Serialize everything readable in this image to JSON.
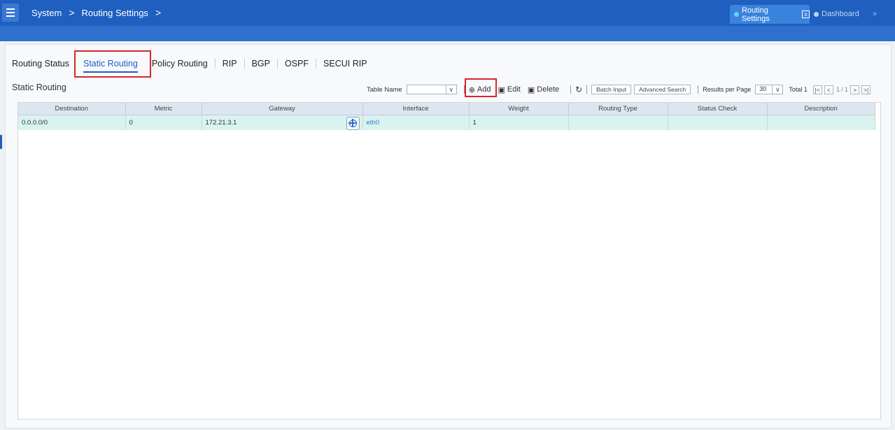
{
  "breadcrumb": {
    "item1": "System",
    "item2": "Routing Settings",
    "sep": ">"
  },
  "window_tabs": {
    "active": "Routing Settings",
    "close": "x",
    "second": "Dashboard",
    "more": "»"
  },
  "tabs": [
    {
      "label": "Routing Status"
    },
    {
      "label": "Static Routing"
    },
    {
      "label": "Policy Routing"
    },
    {
      "label": "RIP"
    },
    {
      "label": "BGP"
    },
    {
      "label": "OSPF"
    },
    {
      "label": "SECUI RIP"
    }
  ],
  "section_title": "Static Routing",
  "toolbar": {
    "table_name_label": "Table Name",
    "table_name_value": "",
    "add_label": "Add",
    "edit_label": "Edit",
    "delete_label": "Delete",
    "batch_input_label": "Batch Input",
    "advanced_search_label": "Advanced Search",
    "results_per_page_label": "Results per Page",
    "results_per_page_value": "30",
    "total_label": "Total 1",
    "page_current": "1",
    "page_total": "1"
  },
  "table": {
    "columns": [
      "Destination",
      "Metric",
      "Gateway",
      "Interface",
      "Weight",
      "Routing Type",
      "Status Check",
      "Description"
    ],
    "rows": [
      {
        "destination": "0.0.0.0/0",
        "metric": "0",
        "gateway": "172.21.3.1",
        "interface": "eth0",
        "weight": "1",
        "routing_type": "",
        "status_check": "",
        "description": ""
      }
    ]
  },
  "colors": {
    "brand_blue": "#1e5fc0",
    "highlight_red": "#d8262a",
    "row_selected": "#d9f3f0"
  },
  "icons": [
    "menu-icon",
    "close-icon",
    "add-circle-icon",
    "edit-icon",
    "delete-icon",
    "refresh-icon",
    "first-page-icon",
    "prev-page-icon",
    "next-page-icon",
    "last-page-icon",
    "gateway-globe-icon",
    "chevron-down-icon"
  ]
}
